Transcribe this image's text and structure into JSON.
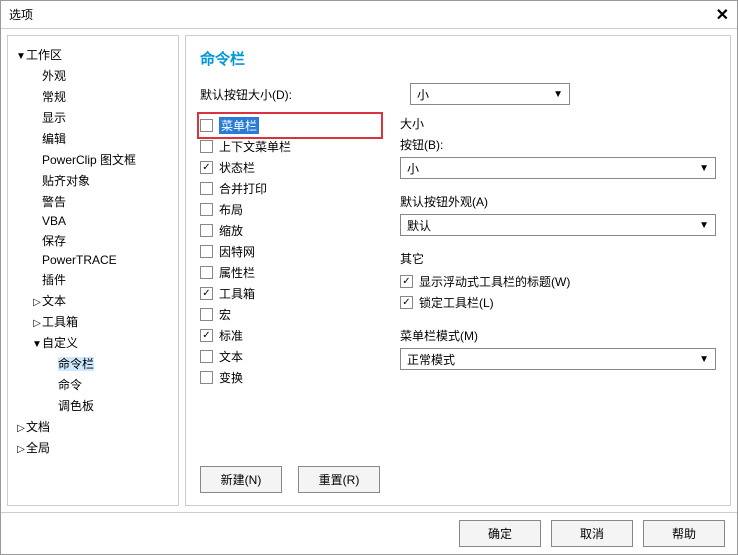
{
  "window": {
    "title": "选项"
  },
  "sidebar": {
    "items": [
      {
        "label": "工作区",
        "caret": "▼",
        "indent": 0
      },
      {
        "label": "外观",
        "caret": "",
        "indent": 1
      },
      {
        "label": "常规",
        "caret": "",
        "indent": 1
      },
      {
        "label": "显示",
        "caret": "",
        "indent": 1
      },
      {
        "label": "编辑",
        "caret": "",
        "indent": 1
      },
      {
        "label": "PowerClip 图文框",
        "caret": "",
        "indent": 1
      },
      {
        "label": "贴齐对象",
        "caret": "",
        "indent": 1
      },
      {
        "label": "警告",
        "caret": "",
        "indent": 1
      },
      {
        "label": "VBA",
        "caret": "",
        "indent": 1
      },
      {
        "label": "保存",
        "caret": "",
        "indent": 1
      },
      {
        "label": "PowerTRACE",
        "caret": "",
        "indent": 1
      },
      {
        "label": "插件",
        "caret": "",
        "indent": 1
      },
      {
        "label": "文本",
        "caret": "▷",
        "indent": 1
      },
      {
        "label": "工具箱",
        "caret": "▷",
        "indent": 1
      },
      {
        "label": "自定义",
        "caret": "▼",
        "indent": 1
      },
      {
        "label": "命令栏",
        "caret": "",
        "indent": 2,
        "selected": true
      },
      {
        "label": "命令",
        "caret": "",
        "indent": 2
      },
      {
        "label": "调色板",
        "caret": "",
        "indent": 2
      },
      {
        "label": "文档",
        "caret": "▷",
        "indent": 0
      },
      {
        "label": "全局",
        "caret": "▷",
        "indent": 0
      }
    ]
  },
  "main": {
    "title": "命令栏",
    "default_size_label": "默认按钮大小(D):",
    "default_size_value": "小",
    "checklist": [
      {
        "label": "菜单栏",
        "checked": false,
        "highlight": true
      },
      {
        "label": "上下文菜单栏",
        "checked": false
      },
      {
        "label": "状态栏",
        "checked": true
      },
      {
        "label": "合并打印",
        "checked": false
      },
      {
        "label": "布局",
        "checked": false
      },
      {
        "label": "缩放",
        "checked": false
      },
      {
        "label": "因特网",
        "checked": false
      },
      {
        "label": "属性栏",
        "checked": false
      },
      {
        "label": "工具箱",
        "checked": true
      },
      {
        "label": "宏",
        "checked": false
      },
      {
        "label": "标准",
        "checked": true
      },
      {
        "label": "文本",
        "checked": false
      },
      {
        "label": "变换",
        "checked": false
      }
    ],
    "size_group": {
      "label": "大小",
      "button_label": "按钮(B):",
      "button_value": "小"
    },
    "appearance_group": {
      "label": "默认按钮外观(A)",
      "value": "默认"
    },
    "other_group": {
      "label": "其它",
      "show_title": {
        "label": "显示浮动式工具栏的标题(W)",
        "checked": true
      },
      "lock": {
        "label": "锁定工具栏(L)",
        "checked": true
      }
    },
    "mode_group": {
      "label": "菜单栏模式(M)",
      "value": "正常模式"
    },
    "buttons": {
      "new": "新建(N)",
      "reset": "重置(R)"
    }
  },
  "footer": {
    "ok": "确定",
    "cancel": "取消",
    "help": "帮助"
  }
}
